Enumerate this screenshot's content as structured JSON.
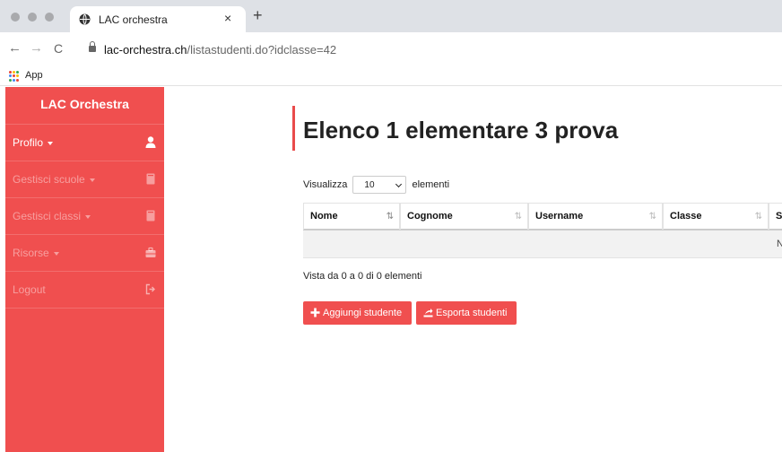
{
  "browser": {
    "tab_title": "LAC orchestra",
    "close_glyph": "×",
    "new_tab_glyph": "+",
    "back_glyph": "←",
    "forward_glyph": "→",
    "reload_glyph": "C",
    "url_host": "lac-orchestra.ch",
    "url_path": "/listastudenti.do?idclasse=42",
    "bookmark_apps": "App"
  },
  "sidebar": {
    "brand": "LAC Orchestra",
    "items": [
      {
        "label": "Profilo",
        "icon": "user-icon",
        "caret": true,
        "active": true
      },
      {
        "label": "Gestisci scuole",
        "icon": "book-icon",
        "caret": true
      },
      {
        "label": "Gestisci classi",
        "icon": "book-icon",
        "caret": true
      },
      {
        "label": "Risorse",
        "icon": "briefcase-icon",
        "caret": true
      },
      {
        "label": "Logout",
        "icon": "sign-out-icon",
        "caret": false
      }
    ]
  },
  "main": {
    "title": "Elenco 1 elementare 3 prova",
    "length": {
      "prefix": "Visualizza",
      "value": "10",
      "suffix": "elementi"
    },
    "table": {
      "headers": [
        "Nome",
        "Cognome",
        "Username",
        "Classe",
        "Sc"
      ],
      "empty_text": "N"
    },
    "info": "Vista da 0 a 0 di 0 elementi",
    "buttons": {
      "add": "Aggiungi studente",
      "export": "Esporta studenti"
    }
  },
  "colors": {
    "accent": "#f04f4f",
    "title_bar": "#e94b4b",
    "empty_row": "#f2f2f2"
  }
}
